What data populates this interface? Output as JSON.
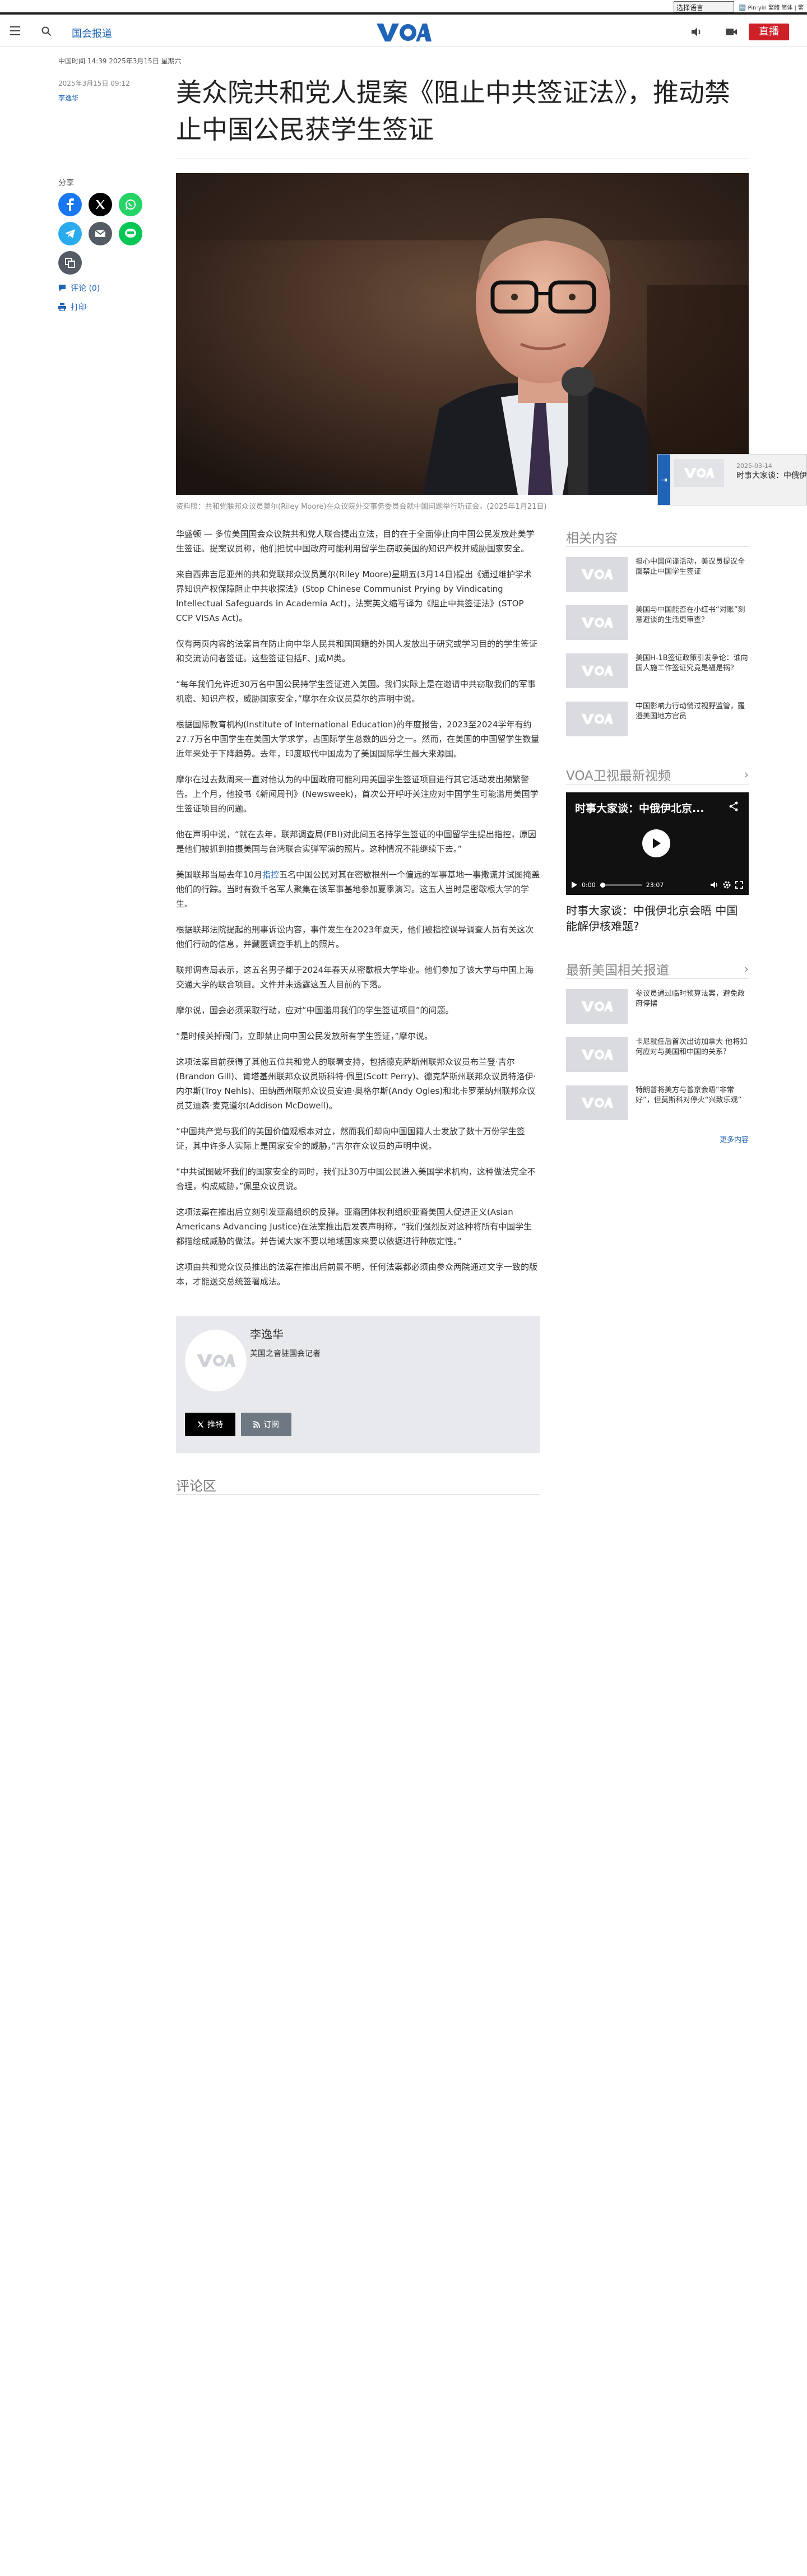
{
  "top_bar": {
    "language_select": "选择语言",
    "language_links": "🔤 Pin-yin 繁體 简体 | 繁"
  },
  "nav": {
    "section": "国会报道",
    "live": "直播",
    "logo_text": "VOA"
  },
  "article": {
    "dateline": "中国时间 14:39 2025年3月15日 星期六",
    "date": "2025年3月15日 09:12",
    "author": "李逸华",
    "headline": "美众院共和党人提案《阻止中共签证法》，推动禁止中国公民获学生签证",
    "caption": "资料照：共和党联邦众议员莫尔(Riley Moore)在众议院外交事务委员会就中国问题举行听证会。(2025年1月21日)",
    "paragraphs": [
      [
        "华盛顿 — 多位美国国会众议院共和党人联合提出立法，目的在于全面停止向中国公民发放赴美学生签证。提案议员称，他们担忧中国政府可能利用留学生窃取美国的知识产权并威胁国家安全。"
      ],
      [
        "来自西弗吉尼亚州的共和党联邦众议员莫尔(Riley Moore)星期五(3月14日)提出《通过维护学术界知识产权保障阻止中共收探法》(Stop Chinese Communist Prying by Vindicating Intellectual Safeguards in Academia Act)，法案英文缩写译为《阻止中共签证法》(STOP CCP VISAs Act)。"
      ],
      [
        "仅有两页内容的法案旨在防止向中华人民共和国国籍的外国人发放出于研究或学习目的的学生签证和交流访问者签证。这些签证包括F、J或M类。"
      ],
      [
        "“每年我们允许近30万名中国公民持学生签证进入美国。我们实际上是在邀请中共窃取我们的军事机密、知识产权，威胁国家安全，”摩尔在众议员莫尔的声明中说。"
      ],
      [
        "根据国际教育机构(Institute of International Education)的年度报告，2023至2024学年有约27.7万名中国学生在美国大学求学，占国际学生总数的四分之一。然而，在美国的中国留学生数量近年来处于下降趋势。去年，印度取代中国成为了美国国际学生最大来源国。"
      ],
      [
        "摩尔在过去数周来一直对他认为的中国政府可能利用美国学生签证项目进行其它活动发出频繁警告。上个月，他投书《新闻周刊》(Newsweek)，首次公开呼吁关注应对中国学生可能滥用美国学生签证项目的问题。"
      ],
      [
        "他在声明中说，“就在去年，联邦调查局(FBI)对此间五名持学生签证的中国留学生提出指控，原因是他们被抓到拍摄美国与台湾联合实弹军演的照片。这种情况不能继续下去。”"
      ],
      [
        "美国联邦当局去年10月",
        {
          "link": "指控"
        },
        "五名中国公民对其在密歇根州一个偏远的军事基地一事撒谎并试图掩盖他们的行踪。当时有数千名军人聚集在该军事基地参加夏季演习。这五人当时是密歇根大学的学生。"
      ],
      [
        "根据联邦法院提起的刑事诉讼内容，事件发生在2023年夏天，他们被指控误导调查人员有关这次他们行动的信息，并藏匿调查手机上的照片。"
      ],
      [
        "联邦调查局表示，这五名男子都于2024年春天从密歇根大学毕业。他们参加了该大学与中国上海交通大学的联合项目。文件并未透露这五人目前的下落。"
      ],
      [
        "摩尔说，国会必须采取行动，应对“中国滥用我们的学生签证项目”的问题。"
      ],
      [
        "“是时候关掉阀门，立即禁止向中国公民发放所有学生签证，”摩尔说。"
      ],
      [
        "这项法案目前获得了其他五位共和党人的联署支持，包括德克萨斯州联邦众议员布兰登·吉尔(Brandon Gill)、肯塔基州联邦众议员斯科特·佩里(Scott Perry)、德克萨斯州联邦众议员特洛伊·内尔斯(Troy Nehls)、田纳西州联邦众议员安迪·奥格尔斯(Andy Ogles)和北卡罗莱纳州联邦众议员艾迪森·麦克道尔(Addison McDowell)。"
      ],
      [
        "“中国共产党与我们的美国价值观根本对立，然而我们却向中国国籍人士发放了数十万份学生签证，其中许多人实际上是国家安全的威胁，”吉尔在众议员的声明中说。"
      ],
      [
        "“中共试图破坏我们的国家安全的同时，我们让30万中国公民进入美国学术机构，这种做法完全不合理，构成威胁，”佩里众议员说。"
      ],
      [
        "这项法案在推出后立刻引发亚裔组织的反弹。亚裔团体权利组织亚裔美国人促进正义(Asian Americans Advancing Justice)在法案推出后发表声明称，“我们强烈反对这种将所有中国学生都描绘成威胁的做法。并告诫大家不要以地域国家来要以依据进行种族定性。”"
      ],
      [
        "这项由共和党众议员推出的法案在推出后前景不明，任何法案都必须由参众两院通过文字一致的版本，才能送交总统签署成法。"
      ]
    ]
  },
  "share": {
    "label": "分享",
    "comments": "评论 (0)",
    "print": "打印"
  },
  "author_box": {
    "name": "李逸华",
    "role": "美国之音驻国会记者",
    "follow": "推特",
    "subscribe": "订阅"
  },
  "comments": {
    "heading": "评论区"
  },
  "sidebar": {
    "related_heading": "相关内容",
    "related": [
      "担心中国间谍活动，美议员提议全面禁止中国学生签证",
      "美国与中国能否在小红书“对账”刻意避谈的生活更审查？",
      "美国H-1B签证政策引发争论：谁向国人施工作签证究竟是福是祸？",
      "中国影响力行动悄过视野监管，羅澄美国地方官员"
    ],
    "video_heading": "VOA卫视最新视频",
    "video_overlay_title": "时事大家谈：中俄伊北京...",
    "video_current_time": "0:00",
    "video_duration": "23:07",
    "video_caption": "时事大家谈：中俄伊北京会晤 中国能解伊核难题?",
    "latest_heading": "最新美国相关报道",
    "latest": [
      "参议员通过临时预算法案，避免政府停摆",
      "卡尼就任后首次出访加拿大 他将如何应对与美国和中国的关系?",
      "特朗普将美方与普京会晤“非常好”，但莫斯科对停火“兴致乐观”"
    ],
    "more": "更多内容"
  },
  "floating_player": {
    "date": "2025-03-14",
    "title": "时事大家谈：中俄伊北京会晤 中国能解伊核难题?"
  },
  "colors": {
    "accent": "#1f64b6",
    "live": "#d02027"
  }
}
